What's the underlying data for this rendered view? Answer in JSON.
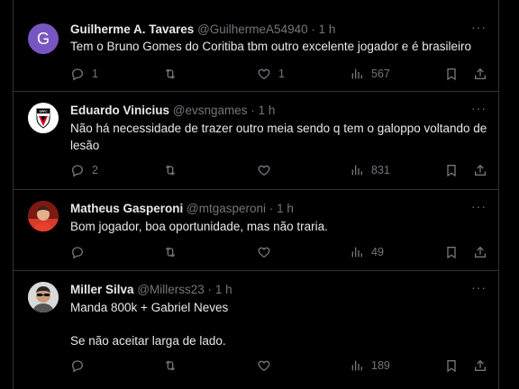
{
  "tweets": [
    {
      "name": "Guilherme A. Tavares",
      "handle": "@GuilhermeA54940",
      "time": "1 h",
      "avatar_letter": "G",
      "text": [
        "Tem o Bruno Gomes do Coritiba tbm outro  excelente jogador e é brasileiro"
      ],
      "replies": "1",
      "retweets": "",
      "likes": "1",
      "views": "567"
    },
    {
      "name": "Eduardo Vinicius",
      "handle": "@evsngames",
      "time": "1 h",
      "avatar_text": "SPFC",
      "text": [
        "Não há necessidade de trazer outro meia sendo q tem o galoppo voltando de lesão"
      ],
      "replies": "2",
      "retweets": "",
      "likes": "",
      "views": "831"
    },
    {
      "name": "Matheus Gasperoni",
      "handle": "@mtgasperoni",
      "time": "1 h",
      "text": [
        "Bom jogador, boa oportunidade, mas não traria."
      ],
      "replies": "",
      "retweets": "",
      "likes": "",
      "views": "49"
    },
    {
      "name": "Miller Silva",
      "handle": "@Millerss23",
      "time": "1 h",
      "text": [
        "Manda 800k + Gabriel Neves",
        "Se não aceitar larga de lado."
      ],
      "replies": "",
      "retweets": "",
      "likes": "",
      "views": "189"
    }
  ],
  "separator": "·",
  "more_label": "···"
}
